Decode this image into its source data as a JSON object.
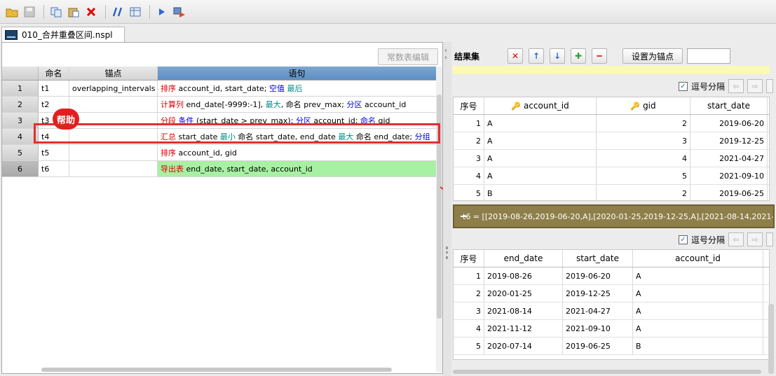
{
  "toolbar": {
    "icons": [
      "open-folder-icon",
      "save-icon",
      "copy-icon",
      "paste-icon",
      "delete-icon",
      "comment-icon",
      "grid-icon",
      "run-icon",
      "debug-icon"
    ],
    "colors": {
      "delete": "#e00000",
      "run": "#2a6ad4"
    }
  },
  "file_tab": {
    "title": "010_合并重叠区间.nspl"
  },
  "editor": {
    "const_button": "常数表编辑",
    "columns": {
      "name": "命名",
      "anchor": "锚点",
      "stmt": "语句"
    },
    "help_badge": "帮助",
    "rows": [
      {
        "num": "1",
        "name": "t1",
        "anchor": "overlapping_intervals",
        "segs": [
          {
            "t": "排序",
            "c": "red"
          },
          {
            "t": " account_id, start_date; ",
            "c": ""
          },
          {
            "t": "空值",
            "c": "blue"
          },
          {
            "t": " ",
            "c": ""
          },
          {
            "t": "最后",
            "c": "teal"
          }
        ]
      },
      {
        "num": "2",
        "name": "t2",
        "anchor": "",
        "segs": [
          {
            "t": "计算列",
            "c": "red"
          },
          {
            "t": " end_date[-9999:-1], ",
            "c": ""
          },
          {
            "t": "最大",
            "c": "teal"
          },
          {
            "t": ", 命名 prev_max; ",
            "c": ""
          },
          {
            "t": "分区",
            "c": "blue"
          },
          {
            "t": " account_id",
            "c": ""
          }
        ]
      },
      {
        "num": "3",
        "name": "t3",
        "anchor": "",
        "segs": [
          {
            "t": "分段",
            "c": "red"
          },
          {
            "t": " ",
            "c": ""
          },
          {
            "t": "条件",
            "c": "blue"
          },
          {
            "t": " (start_date > prev_max); ",
            "c": ""
          },
          {
            "t": "分区",
            "c": "blue"
          },
          {
            "t": " account_id; ",
            "c": ""
          },
          {
            "t": "命名",
            "c": "blue"
          },
          {
            "t": " gid",
            "c": ""
          }
        ]
      },
      {
        "num": "4",
        "name": "t4",
        "anchor": "",
        "segs": [
          {
            "t": "汇总",
            "c": "red"
          },
          {
            "t": " start_date ",
            "c": ""
          },
          {
            "t": "最小",
            "c": "teal"
          },
          {
            "t": " 命名 start_date, end_date ",
            "c": ""
          },
          {
            "t": "最大",
            "c": "teal"
          },
          {
            "t": " 命名 end_date; ",
            "c": ""
          },
          {
            "t": "分组",
            "c": "blue"
          }
        ]
      },
      {
        "num": "5",
        "name": "t5",
        "anchor": "",
        "segs": [
          {
            "t": "排序",
            "c": "red"
          },
          {
            "t": " account_id, gid",
            "c": ""
          }
        ]
      },
      {
        "num": "6",
        "name": "t6",
        "anchor": "",
        "segs": [
          {
            "t": "导出表",
            "c": "red"
          },
          {
            "t": " end_date, start_date, account_id",
            "c": ""
          }
        ]
      }
    ]
  },
  "results": {
    "label": "结果集",
    "anchor_button": "设置为锚点",
    "anchor_input": "",
    "comma_label": "逗号分隔",
    "table1": {
      "headers": [
        "序号",
        "account_id",
        "gid",
        "start_date"
      ],
      "rows": [
        [
          "1",
          "A",
          "2",
          "2019-06-20"
        ],
        [
          "2",
          "A",
          "3",
          "2019-12-25"
        ],
        [
          "3",
          "A",
          "4",
          "2021-04-27"
        ],
        [
          "4",
          "A",
          "5",
          "2021-09-10"
        ],
        [
          "5",
          "B",
          "2",
          "2019-06-25"
        ]
      ]
    },
    "expression": "t6 = [[2019-08-26,2019-06-20,A],[2020-01-25,2019-12-25,A],[2021-08-14,2021-0",
    "table2": {
      "headers": [
        "序号",
        "end_date",
        "start_date",
        "account_id"
      ],
      "rows": [
        [
          "1",
          "2019-08-26",
          "2019-06-20",
          "A"
        ],
        [
          "2",
          "2020-01-25",
          "2019-12-25",
          "A"
        ],
        [
          "3",
          "2021-08-14",
          "2021-04-27",
          "A"
        ],
        [
          "4",
          "2021-11-12",
          "2021-09-10",
          "A"
        ],
        [
          "5",
          "2020-07-14",
          "2019-06-25",
          "B"
        ]
      ]
    }
  }
}
